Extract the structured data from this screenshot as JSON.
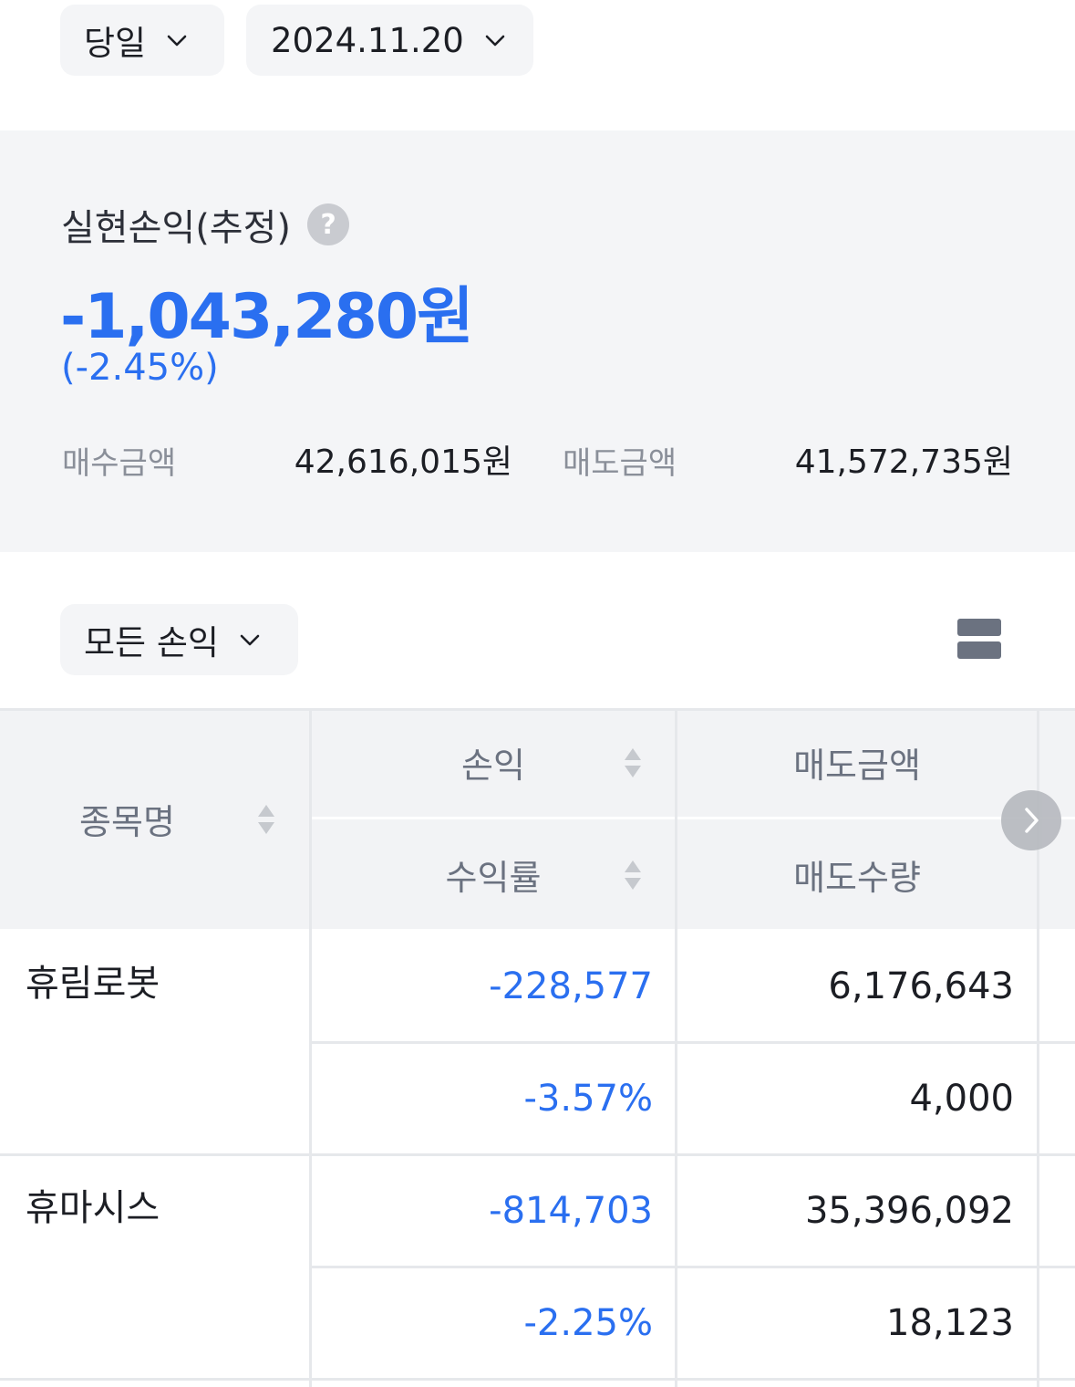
{
  "filters": {
    "period": "당일",
    "date": "2024.11.20",
    "profit_filter": "모든 손익"
  },
  "summary": {
    "title": "실현손익(추정)",
    "help_icon": "?",
    "amount": "-1,043,280원",
    "rate": "(-2.45%)",
    "buy_label": "매수금액",
    "buy_value": "42,616,015원",
    "sell_label": "매도금액",
    "sell_value": "41,572,735원"
  },
  "table": {
    "headers": {
      "name": "종목명",
      "profit": "손익",
      "return_rate": "수익률",
      "sell_amount": "매도금액",
      "sell_qty": "매도수량"
    },
    "rows": [
      {
        "name": "휴림로봇",
        "profit": "-228,577",
        "return_rate": "-3.57%",
        "sell_amount": "6,176,643",
        "sell_qty": "4,000"
      },
      {
        "name": "휴마시스",
        "profit": "-814,703",
        "return_rate": "-2.25%",
        "sell_amount": "35,396,092",
        "sell_qty": "18,123"
      }
    ]
  },
  "colors": {
    "loss_blue": "#2a6ff0",
    "panel_bg": "#f4f5f7",
    "header_bg": "#f2f3f5"
  },
  "icons": [
    "chevron-down-icon",
    "help-icon",
    "menu-icon",
    "sort-icon",
    "chevron-right-icon"
  ]
}
